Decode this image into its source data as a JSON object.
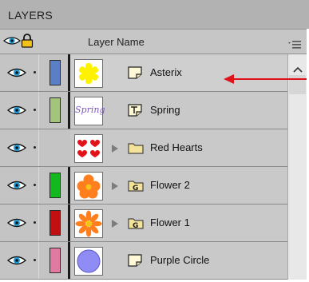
{
  "panel": {
    "title": "LAYERS"
  },
  "header": {
    "column_label": "Layer Name",
    "icons": [
      "eye-icon",
      "lock-icon",
      "panel-menu-icon"
    ]
  },
  "layers": [
    {
      "name": "Asterix",
      "type": "shape-layer",
      "color": "#5b7fc4",
      "thumbnail": "yellow asterisk",
      "has_group_arrow": false,
      "selected": true
    },
    {
      "name": "Spring",
      "type": "text-layer",
      "color": "#a3c47a",
      "thumbnail": "spring text",
      "has_group_arrow": false,
      "selected": false
    },
    {
      "name": "Red Hearts",
      "type": "folder-layer",
      "color": "#c9c9c9",
      "thumbnail": "red hearts",
      "has_group_arrow": true,
      "selected": false
    },
    {
      "name": "Flower 2",
      "type": "group-layer",
      "color": "#12b81d",
      "thumbnail": "orange flower",
      "has_group_arrow": true,
      "selected": false
    },
    {
      "name": "Flower 1",
      "type": "group-layer",
      "color": "#c20f12",
      "thumbnail": "orange sun flower",
      "has_group_arrow": true,
      "selected": false
    },
    {
      "name": "Purple Circle",
      "type": "shape-layer",
      "color": "#e07aa0",
      "thumbnail": "purple circle",
      "has_group_arrow": false,
      "selected": false
    }
  ],
  "spring_thumbnail_text": "Spring",
  "accent_colors": {
    "annotation_arrow": "#e0131b",
    "panel_bg": "#c9c9c9"
  }
}
